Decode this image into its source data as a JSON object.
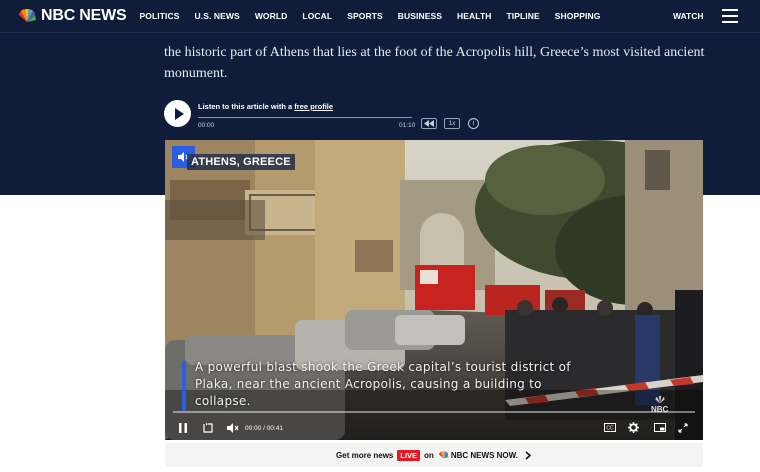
{
  "nav": {
    "brand": "NBC NEWS",
    "items": [
      "POLITICS",
      "U.S. NEWS",
      "WORLD",
      "LOCAL",
      "SPORTS",
      "BUSINESS",
      "HEALTH",
      "TIPLINE",
      "SHOPPING"
    ],
    "watch": "WATCH"
  },
  "article": {
    "text": "the historic part of Athens that lies at the foot of the Acropolis hill, Greece’s most visited ancient monument."
  },
  "audio": {
    "listen_prefix": "Listen to this article with a",
    "listen_link": "free profile",
    "current_time": "00:00",
    "duration": "01:10",
    "speed": "1x",
    "progress": 0
  },
  "video": {
    "location_tag": "ATHENS, GREECE",
    "caption": "A powerful blast shook the Greek capital’s tourist district of Plaka, near the ancient Acropolis, causing a building to collapse.",
    "time": "00:00 / 00:41",
    "watermark": "NBC",
    "progress": 0
  },
  "promo": {
    "prefix": "Get more news",
    "live": "LIVE",
    "on": "on",
    "brand": "NBC NEWS NOW."
  },
  "colors": {
    "nav_bg": "#0f1d3a",
    "accent_blue": "#2a5de0",
    "live_red": "#e51b23"
  }
}
